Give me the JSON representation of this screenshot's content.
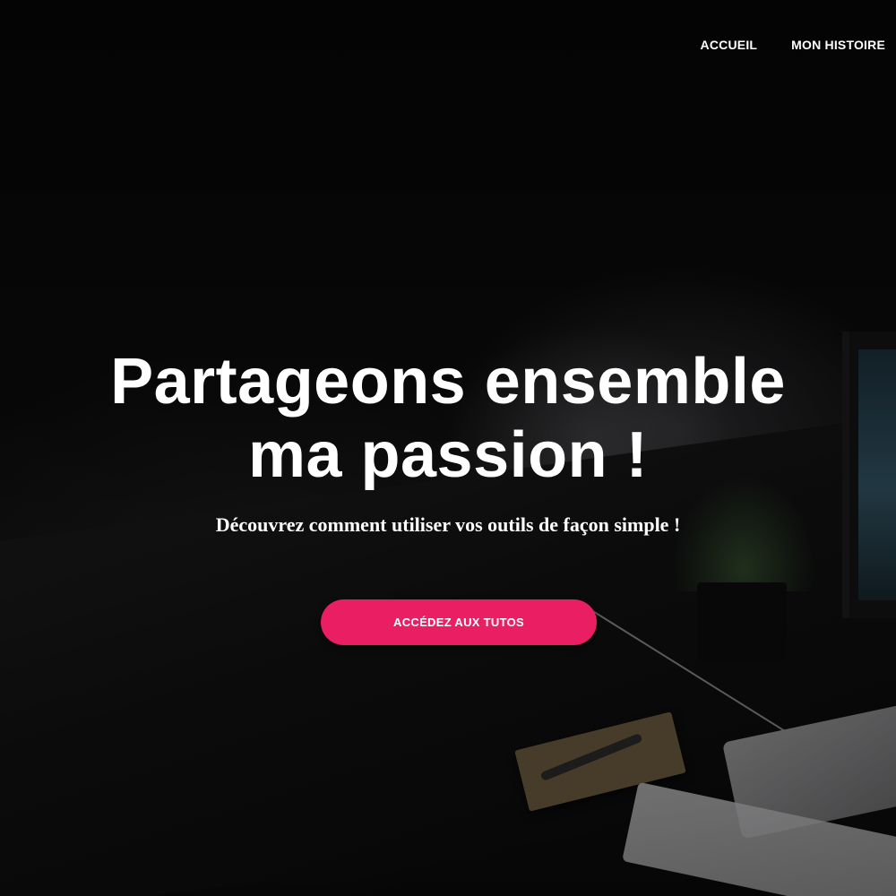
{
  "nav": {
    "items": [
      {
        "label": "ACCUEIL"
      },
      {
        "label": "MON HISTOIRE"
      }
    ]
  },
  "hero": {
    "title_line1": "Partageons ensemble",
    "title_line2": "ma passion !",
    "subtitle": "Découvrez comment utiliser vos outils de façon simple !",
    "cta_label": "ACCÉDEZ AUX TUTOS"
  },
  "colors": {
    "accent": "#e91e63",
    "text": "#ffffff",
    "background": "#050505"
  }
}
